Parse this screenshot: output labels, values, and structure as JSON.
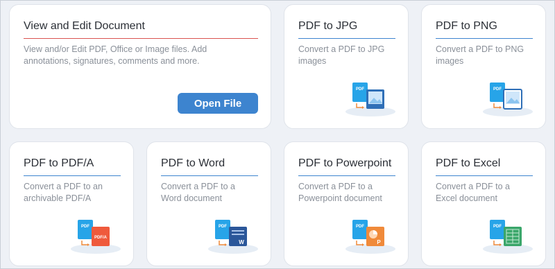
{
  "main_card": {
    "title": "View and Edit Document",
    "description_line1": "View and/or Edit PDF, Office or Image files. Add",
    "description_line2": "annotations, signatures, comments and more.",
    "button_label": "Open File"
  },
  "tools": [
    {
      "title": "PDF to JPG",
      "desc_line1": "Convert a PDF to JPG",
      "desc_line2": "images",
      "icon": "pdf-to-image-icon"
    },
    {
      "title": "PDF to PNG",
      "desc_line1": "Convert a PDF to PNG",
      "desc_line2": "images",
      "icon": "pdf-to-image-icon"
    },
    {
      "title": "PDF to PDF/A",
      "desc_line1": "Convert a PDF to an",
      "desc_line2": "archivable PDF/A",
      "icon": "pdf-to-pdfa-icon",
      "badge": "PDF/A"
    },
    {
      "title": "PDF to Word",
      "desc_line1": "Convert a PDF to a",
      "desc_line2": "Word document",
      "icon": "pdf-to-word-icon",
      "badge": "W"
    },
    {
      "title": "PDF to Powerpoint",
      "desc_line1": "Convert a PDF to a",
      "desc_line2": "Powerpoint document",
      "icon": "pdf-to-powerpoint-icon",
      "badge": "P"
    },
    {
      "title": "PDF to Excel",
      "desc_line1": "Convert a PDF to a",
      "desc_line2": "Excel document",
      "icon": "pdf-to-excel-icon"
    }
  ],
  "pdf_badge": "PDF",
  "colors": {
    "main_underline": "#d9534f",
    "tool_underline": "#3d84cf",
    "button": "#3d84cf",
    "pdf_blue": "#27a4e8",
    "pdfa_red": "#ef5a3c",
    "word_blue": "#2b579a",
    "ppt_orange": "#f08a3a",
    "excel_green": "#3aa66a"
  }
}
